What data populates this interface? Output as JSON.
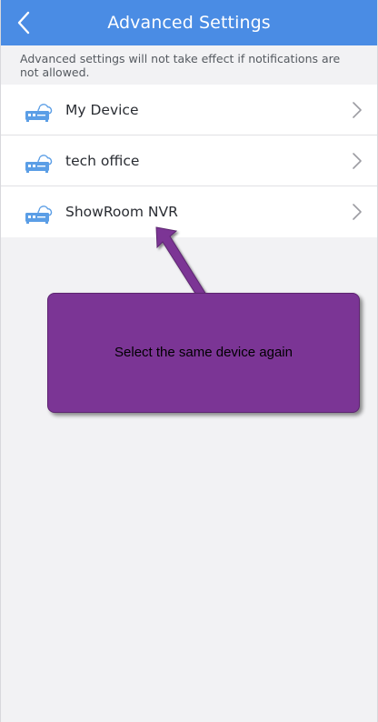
{
  "header": {
    "title": "Advanced Settings",
    "background": "#4a8ce4",
    "back_icon": "chevron-left-icon"
  },
  "notice": {
    "text": "Advanced settings will not take effect if notifications are not allowed."
  },
  "devices": [
    {
      "label": "My Device",
      "icon": "cloud-nvr-icon"
    },
    {
      "label": "tech office",
      "icon": "cloud-nvr-icon"
    },
    {
      "label": "ShowRoom NVR",
      "icon": "cloud-nvr-icon"
    }
  ],
  "annotation": {
    "text": "Select the same device again",
    "color": "#7b3595"
  }
}
